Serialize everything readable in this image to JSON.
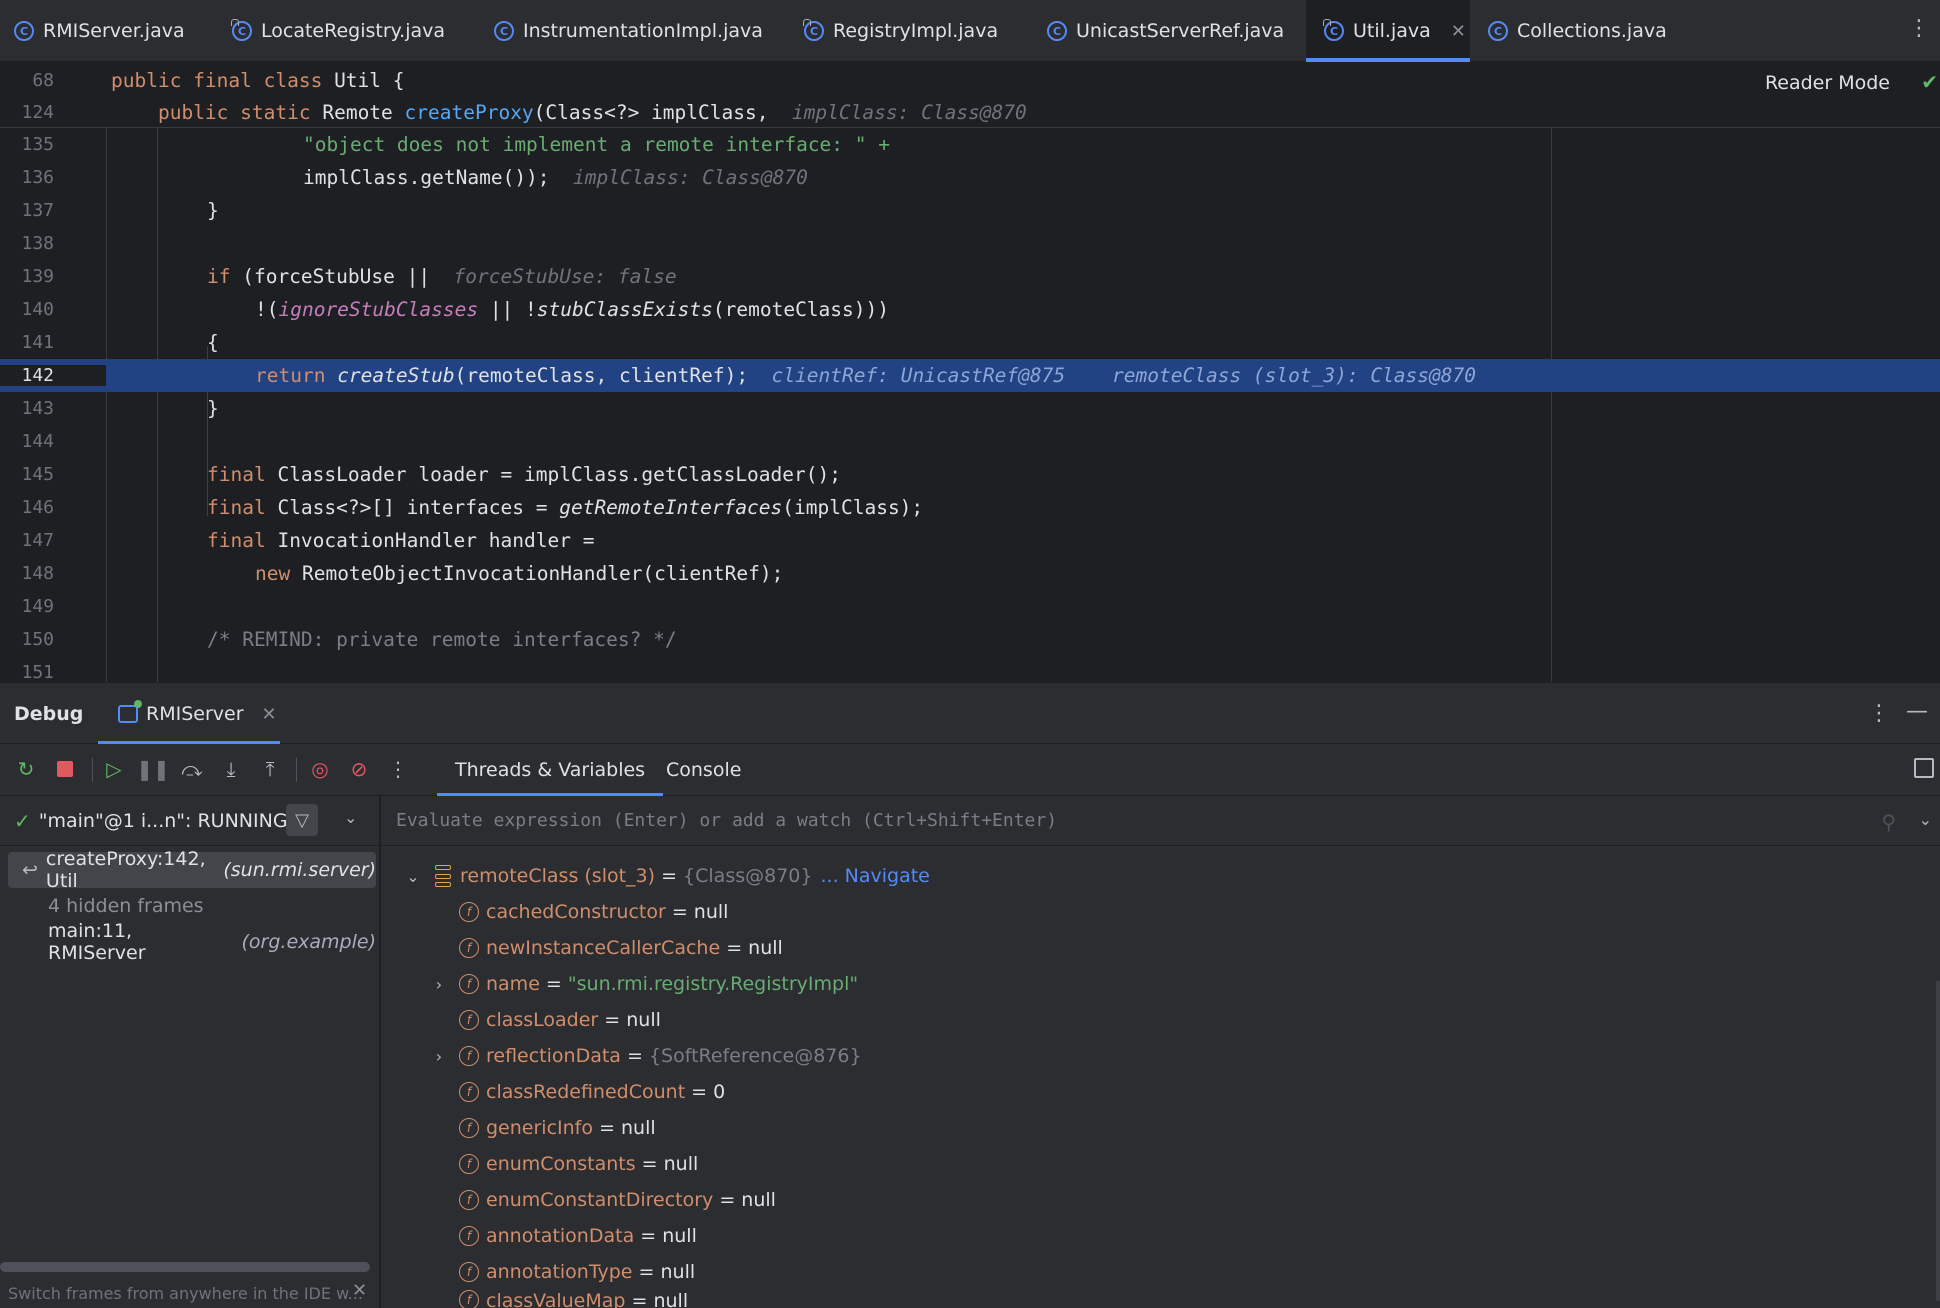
{
  "tabs": [
    {
      "label": "RMIServer.java",
      "icon": "java-class-icon"
    },
    {
      "label": "LocateRegistry.java",
      "icon": "locked-class-icon"
    },
    {
      "label": "InstrumentationImpl.java",
      "icon": "class-icon"
    },
    {
      "label": "RegistryImpl.java",
      "icon": "locked-class-icon"
    },
    {
      "label": "UnicastServerRef.java",
      "icon": "class-icon"
    },
    {
      "label": "Util.java",
      "icon": "locked-class-icon",
      "active": true
    },
    {
      "label": "Collections.java",
      "icon": "class-icon"
    }
  ],
  "editor": {
    "reader_mode": "Reader Mode",
    "sticky": [
      {
        "ln": "68",
        "code": "public final class Util {"
      },
      {
        "ln": "124",
        "code": "    public static Remote createProxy(Class<?> implClass,",
        "hint": "implClass: Class@870"
      }
    ],
    "lines": [
      {
        "ln": "135",
        "code": "\"object does not implement a remote interface: \" +"
      },
      {
        "ln": "136",
        "code": "implClass.getName());",
        "hint": "implClass: Class@870"
      },
      {
        "ln": "137",
        "code": "}"
      },
      {
        "ln": "138",
        "code": ""
      },
      {
        "ln": "139",
        "code": "if (forceStubUse ||",
        "hint": "forceStubUse: false"
      },
      {
        "ln": "140",
        "code": "!(ignoreStubClasses || !stubClassExists(remoteClass)))"
      },
      {
        "ln": "141",
        "code": "{"
      },
      {
        "ln": "142",
        "code": "return createStub(remoteClass, clientRef);",
        "hint": "clientRef: UnicastRef@875",
        "hint2": "remoteClass (slot_3): Class@870"
      },
      {
        "ln": "143",
        "code": "}"
      },
      {
        "ln": "144",
        "code": ""
      },
      {
        "ln": "145",
        "code": "final ClassLoader loader = implClass.getClassLoader();"
      },
      {
        "ln": "146",
        "code": "final Class<?>[] interfaces = getRemoteInterfaces(implClass);"
      },
      {
        "ln": "147",
        "code": "final InvocationHandler handler ="
      },
      {
        "ln": "148",
        "code": "new RemoteObjectInvocationHandler(clientRef);"
      },
      {
        "ln": "149",
        "code": ""
      },
      {
        "ln": "150",
        "code": "/* REMIND: private remote interfaces? */"
      },
      {
        "ln": "151",
        "code": ""
      }
    ]
  },
  "debug": {
    "title": "Debug",
    "session_tab": "RMIServer",
    "tabs": [
      "Threads & Variables",
      "Console"
    ],
    "thread": "\"main\"@1 i...n\": RUNNING",
    "frames": [
      {
        "method": "createProxy:142, Util",
        "pkg": "(sun.rmi.server)",
        "selected": true
      },
      {
        "method": "4 hidden frames",
        "pkg": ""
      },
      {
        "method": "main:11, RMIServer",
        "pkg": "(org.example)"
      }
    ],
    "frames_hint": "Switch frames from anywhere in the IDE w...",
    "watch_placeholder": "Evaluate expression (Enter) or add a watch (Ctrl+Shift+Enter)",
    "variables": [
      {
        "name": "remoteClass (slot_3)",
        "value": "{Class@870}",
        "extra": "... Navigate",
        "kind": "slot",
        "expanded": true
      },
      {
        "name": "cachedConstructor",
        "value": "null"
      },
      {
        "name": "newInstanceCallerCache",
        "value": "null"
      },
      {
        "name": "name",
        "value": "\"sun.rmi.registry.RegistryImpl\"",
        "kind": "str",
        "expandable": true
      },
      {
        "name": "classLoader",
        "value": "null"
      },
      {
        "name": "reflectionData",
        "value": "{SoftReference@876}",
        "kind": "ref",
        "expandable": true
      },
      {
        "name": "classRedefinedCount",
        "value": "0"
      },
      {
        "name": "genericInfo",
        "value": "null"
      },
      {
        "name": "enumConstants",
        "value": "null"
      },
      {
        "name": "enumConstantDirectory",
        "value": "null"
      },
      {
        "name": "annotationData",
        "value": "null"
      },
      {
        "name": "annotationType",
        "value": "null"
      },
      {
        "name": "classValueMap",
        "value": "null"
      }
    ]
  }
}
